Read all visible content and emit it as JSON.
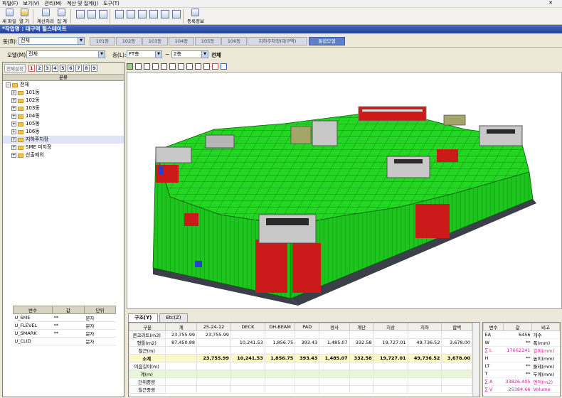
{
  "menu": [
    "파일(F)",
    "보기(V)",
    "관리(M)",
    "계산 및 집계(J)",
    "도구(T)"
  ],
  "window_close": "✕",
  "toolbar": {
    "buttons": [
      {
        "label": "새 파일",
        "icon": "new-file-icon"
      },
      {
        "label": "열 기",
        "icon": "open-icon"
      },
      {
        "label": "계산처리",
        "icon": "calculate-icon"
      },
      {
        "label": "집 계",
        "icon": "aggregate-icon"
      },
      {
        "label": "등록정보",
        "icon": "properties-icon"
      }
    ]
  },
  "title": "*작업명 : 대구역 힐스테이트",
  "building": {
    "label": "동(B):",
    "value": "전체",
    "tabs": [
      "101동",
      "102동",
      "103동",
      "104동",
      "105동",
      "106동",
      "지하주차장(대구역)",
      "통합모델"
    ],
    "active_tab": "통합모델"
  },
  "filter": {
    "model_label": "모델(M):",
    "model_value": "전체",
    "floor_label": "층(L):",
    "floor_from": "FT층",
    "tilde": "~",
    "floor_to": "2층",
    "floor_all": "전체"
  },
  "tree": {
    "toolbar_label": "전체설정",
    "numbers": [
      "1",
      "2",
      "3",
      "4",
      "5",
      "6",
      "7",
      "8",
      "9"
    ],
    "header": "분류",
    "items": [
      {
        "label": "전체",
        "level": 0,
        "expand": "−"
      },
      {
        "label": "101동",
        "level": 1,
        "expand": "+"
      },
      {
        "label": "102동",
        "level": 1,
        "expand": "+"
      },
      {
        "label": "103동",
        "level": 1,
        "expand": "+"
      },
      {
        "label": "104동",
        "level": 1,
        "expand": "+"
      },
      {
        "label": "105동",
        "level": 1,
        "expand": "+"
      },
      {
        "label": "106동",
        "level": 1,
        "expand": "+"
      },
      {
        "label": "지하주차장",
        "level": 1,
        "expand": "+",
        "selected": true
      },
      {
        "label": "SME 미지정",
        "level": 1,
        "expand": "+"
      },
      {
        "label": "산출제외",
        "level": 1,
        "expand": "+"
      }
    ]
  },
  "vars": {
    "headers": [
      "변수",
      "값",
      "단위"
    ],
    "rows": [
      [
        "U_SME",
        "**",
        "문자"
      ],
      [
        "U_FLEVEL",
        "**",
        "문자"
      ],
      [
        "U_SMARK",
        "**",
        "문자"
      ],
      [
        "U_CLID",
        "",
        "문자"
      ]
    ]
  },
  "bottom_tabs": [
    "구조(Y)",
    "Etc(Z)"
  ],
  "qty": {
    "headers": [
      "구분",
      "계",
      "25-24-12",
      "DECK",
      "DH-BEAM",
      "PAD",
      "경사",
      "계단",
      "지상",
      "지하",
      "합벽"
    ],
    "rows": [
      {
        "cells": [
          "콘크리트(m3)",
          "23,755.99",
          "23,755.99",
          "",
          "",
          "",
          "",
          "",
          "",
          "",
          ""
        ],
        "type": ""
      },
      {
        "cells": [
          "형틀(m2)",
          "87,450.88",
          "",
          "10,241.53",
          "1,856.75",
          "393.43",
          "1,485.07",
          "332.58",
          "19,727.01",
          "49,736.52",
          "3,678.00"
        ],
        "type": ""
      },
      {
        "cells": [
          "철근(m)",
          "",
          "",
          "",
          "",
          "",
          "",
          "",
          "",
          "",
          ""
        ],
        "type": ""
      },
      {
        "cells": [
          "소계",
          "",
          "23,755.99",
          "10,241.53",
          "1,856.75",
          "393.43",
          "1,485.07",
          "332.58",
          "19,727.01",
          "49,736.52",
          "3,678.00"
        ],
        "type": "sub"
      },
      {
        "cells": [
          "이음길이(m)",
          "",
          "",
          "",
          "",
          "",
          "",
          "",
          "",
          "",
          ""
        ],
        "type": ""
      },
      {
        "cells": [
          "계(m)",
          "",
          "",
          "",
          "",
          "",
          "",
          "",
          "",
          "",
          ""
        ],
        "type": "grn"
      },
      {
        "cells": [
          "단위중량",
          "",
          "",
          "",
          "",
          "",
          "",
          "",
          "",
          "",
          ""
        ],
        "type": ""
      },
      {
        "cells": [
          "철근중량",
          "",
          "",
          "",
          "",
          "",
          "",
          "",
          "",
          "",
          ""
        ],
        "type": ""
      }
    ]
  },
  "props": {
    "headers": [
      "변수",
      "값",
      "비고"
    ],
    "rows": [
      {
        "key": "EA",
        "val": "6456",
        "note": "개수",
        "pink": false
      },
      {
        "key": "W",
        "val": "**",
        "note": "폭(mm)",
        "pink": false
      },
      {
        "key": "∑ L",
        "val": "17662241",
        "note": "길이(mm)",
        "pink": true
      },
      {
        "key": "H",
        "val": "**",
        "note": "높이(mm)",
        "pink": false
      },
      {
        "key": "LT",
        "val": "**",
        "note": "둘레(mm)",
        "pink": false
      },
      {
        "key": "T",
        "val": "**",
        "note": "두께(mm)",
        "pink": false
      },
      {
        "key": "∑ A",
        "val": "33826.405",
        "note": "면적(m2)",
        "pink": true
      },
      {
        "key": "∑ V",
        "val": "25384.66",
        "note": "Volume",
        "pink": true
      }
    ]
  }
}
